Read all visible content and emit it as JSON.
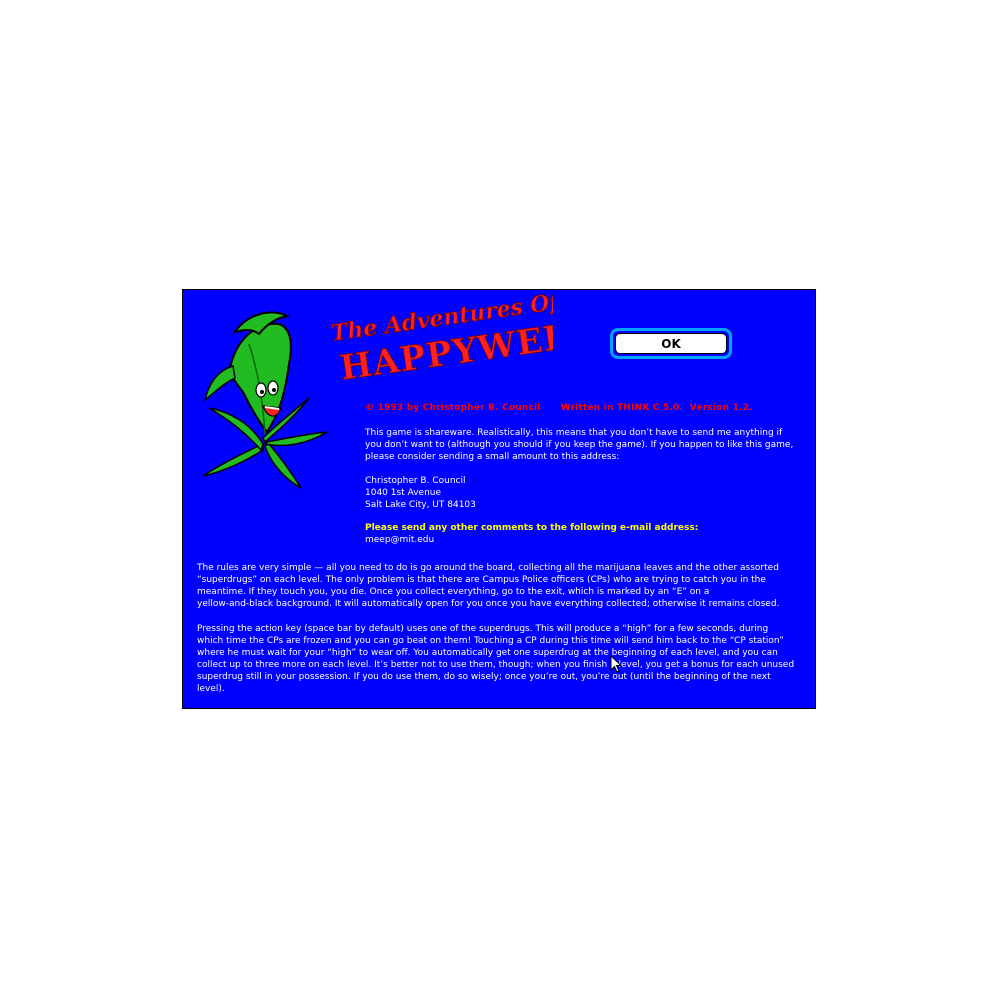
{
  "dialog": {
    "title_art": {
      "line1": "The Adventures Of",
      "line2": "HAPPYWEED!"
    },
    "ok_button_label": "OK",
    "credits": {
      "copyright": "© 1993 by Christopher B. Council",
      "written_in": "Written in THINK C 5.0.",
      "version": "Version 1.2."
    },
    "shareware_lines": [
      "This game is shareware.  Realistically, this means that you don’t have to send me anything if",
      "you don’t want to (although you should if you keep the game).  If you happen to like this game,",
      "please consider sending a small amount to this address:"
    ],
    "address_lines": [
      "Christopher B. Council",
      "1040 1st Avenue",
      "Salt Lake City, UT  84103"
    ],
    "email_heading": "Please send any other comments to the following e-mail address:",
    "email_address": "meep@mit.edu",
    "rules_para_1": [
      "The rules are very simple — all you need to do is go around the board, collecting all the marijuana leaves and the other assorted",
      "“superdrugs” on each level.  The only problem is that there are Campus Police officers (CPs) who are trying to catch you in the",
      "meantime.  If they touch you, you die.  Once you collect everything, go to the exit, which is marked by an “E” on a",
      "yellow-and-black background.  It will automatically open for you once you have everything collected; otherwise it remains closed."
    ],
    "rules_para_2": [
      "Pressing the action key (space bar by default) uses one of the superdrugs.  This will produce a “high” for a few seconds, during",
      "which time the CPs are frozen and you can go beat on them!  Touching a CP during this time will send him back to the “CP station”",
      "where he must wait for your “high” to wear off.  You automatically get one superdrug at the beginning of each level, and you can",
      "collect up to three more on each level.  It’s better not to use them, though; when you finish a level, you get a bonus for each unused",
      "superdrug still in your possession.  If you do use them, do so wisely; once you’re out, you’re out (until the beginning of the next",
      "level)."
    ]
  },
  "icons": {
    "mascot": "marijuana-leaf-mascot-icon",
    "cursor": "arrow-cursor-icon"
  },
  "colors": {
    "dialog_background": "#0000ff",
    "body_text": "#ffffff",
    "credits_text": "#ff0000",
    "email_heading_text": "#ffff00",
    "leaf_green": "#22bb22",
    "title_red": "#ff2020",
    "ok_ring": "#00a5ff"
  }
}
